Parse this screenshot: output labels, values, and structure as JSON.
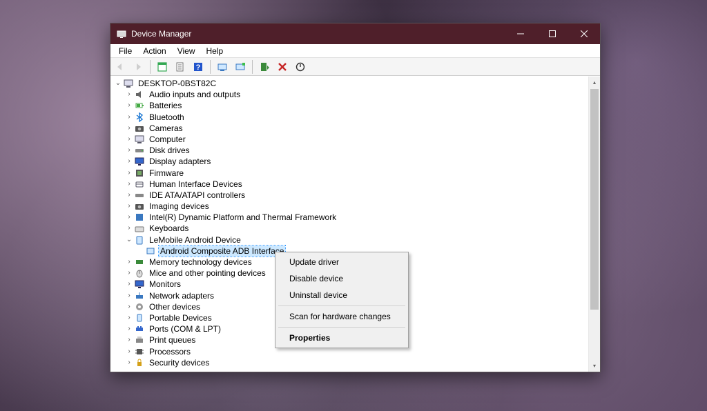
{
  "window": {
    "title": "Device Manager"
  },
  "menubar": {
    "file": "File",
    "action": "Action",
    "view": "View",
    "help": "Help"
  },
  "tree": {
    "root": "DESKTOP-0BST82C",
    "items": [
      "Audio inputs and outputs",
      "Batteries",
      "Bluetooth",
      "Cameras",
      "Computer",
      "Disk drives",
      "Display adapters",
      "Firmware",
      "Human Interface Devices",
      "IDE ATA/ATAPI controllers",
      "Imaging devices",
      "Intel(R) Dynamic Platform and Thermal Framework",
      "Keyboards",
      "LeMobile Android Device",
      "Memory technology devices",
      "Mice and other pointing devices",
      "Monitors",
      "Network adapters",
      "Other devices",
      "Portable Devices",
      "Ports (COM & LPT)",
      "Print queues",
      "Processors",
      "Security devices"
    ],
    "expanded_child": "Android Composite ADB Interface"
  },
  "context_menu": {
    "update": "Update driver",
    "disable": "Disable device",
    "uninstall": "Uninstall device",
    "scan": "Scan for hardware changes",
    "properties": "Properties"
  }
}
